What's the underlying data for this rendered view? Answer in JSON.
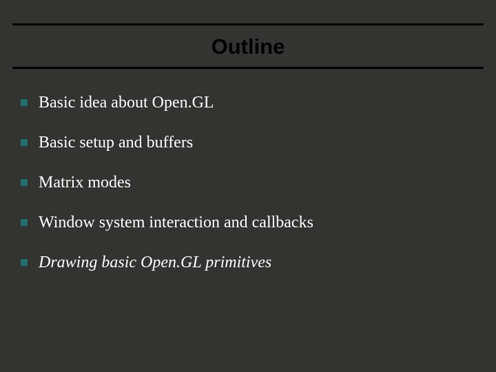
{
  "title": "Outline",
  "bullets": [
    {
      "text": "Basic idea about Open.GL",
      "italic": false
    },
    {
      "text": "Basic setup and buffers",
      "italic": false
    },
    {
      "text": "Matrix modes",
      "italic": false
    },
    {
      "text": "Window system interaction and callbacks",
      "italic": false
    },
    {
      "text": "Drawing basic Open.GL primitives",
      "italic": true
    }
  ],
  "colors": {
    "accent": "#236e6b",
    "background": "#333331"
  }
}
